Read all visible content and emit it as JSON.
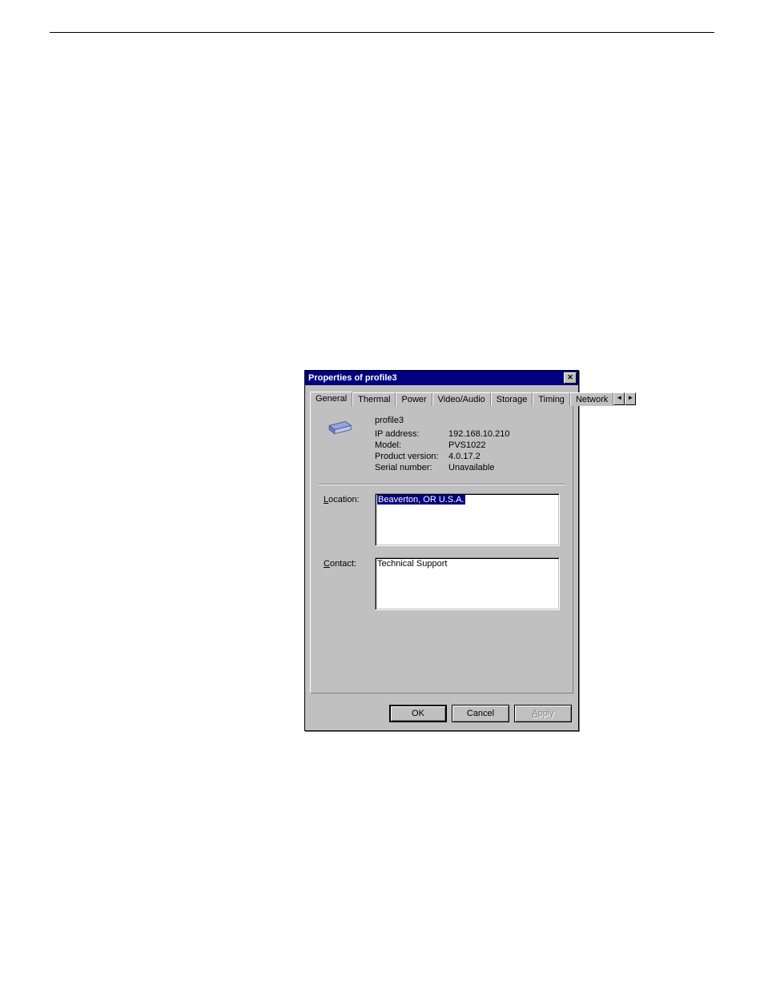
{
  "dialog": {
    "title": "Properties of profile3",
    "tabs": [
      "General",
      "Thermal",
      "Power",
      "Video/Audio",
      "Storage",
      "Timing",
      "Network"
    ],
    "active_tab": "General"
  },
  "general": {
    "name": "profile3",
    "fields": {
      "ip_label": "IP address:",
      "ip_value": "192.168.10.210",
      "model_label": "Model:",
      "model_value": "PVS1022",
      "version_label": "Product version:",
      "version_value": "4.0.17.2",
      "serial_label": "Serial number:",
      "serial_value": "Unavailable"
    },
    "location_label": "Location:",
    "location_value": "Beaverton, OR U.S.A.",
    "contact_label": "Contact:",
    "contact_value": "Technical Support"
  },
  "buttons": {
    "ok": "OK",
    "cancel": "Cancel",
    "apply": "Apply"
  }
}
